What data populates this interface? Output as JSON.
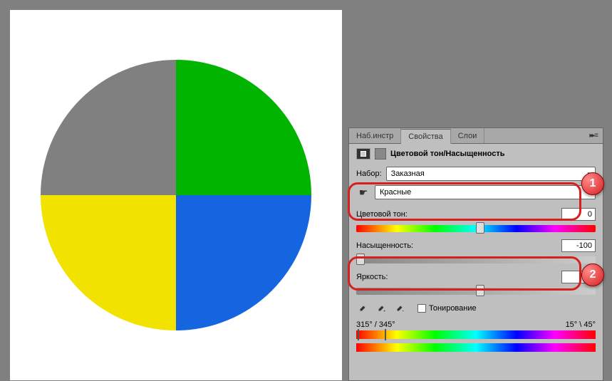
{
  "tabs": {
    "t1": "Наб.инстр",
    "t2": "Свойства",
    "t3": "Слои"
  },
  "panel": {
    "title": "Цветовой тон/Насыщенность",
    "preset_label": "Набор:",
    "preset_value": "Заказная",
    "channel_value": "Красные",
    "hue_label": "Цветовой тон:",
    "sat_label": "Насыщенность:",
    "light_label": "Яркость:",
    "colorize_label": "Тонирование",
    "range_left": "315° / 345°",
    "range_right": "15° \\ 45°"
  },
  "values": {
    "hue": "0",
    "saturation": "-100",
    "lightness": "0"
  },
  "callouts": {
    "one": "1",
    "two": "2"
  },
  "icons": {
    "menu": "▸▸ ≡",
    "chevron": "▾",
    "hand": "☛"
  }
}
